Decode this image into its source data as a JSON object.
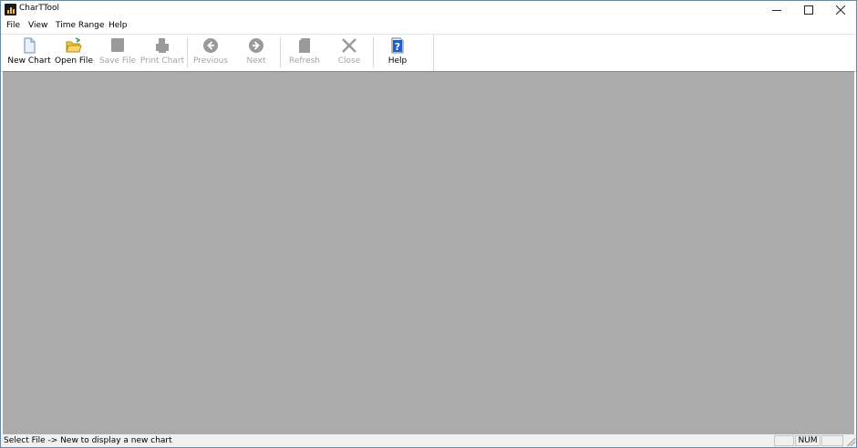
{
  "window": {
    "title": "CharTTool"
  },
  "menu": {
    "items": [
      "File",
      "View",
      "Time Range",
      "Help"
    ]
  },
  "toolbar": {
    "buttons": [
      {
        "label": "New Chart",
        "icon": "new-document-icon",
        "enabled": true
      },
      {
        "label": "Open File",
        "icon": "open-folder-icon",
        "enabled": true
      },
      {
        "label": "Save File",
        "icon": "save-icon",
        "enabled": false
      },
      {
        "label": "Print Chart",
        "icon": "print-icon",
        "enabled": false
      },
      {
        "label": "Previous",
        "icon": "arrow-left-icon",
        "enabled": false
      },
      {
        "label": "Next",
        "icon": "arrow-right-icon",
        "enabled": false
      },
      {
        "label": "Refresh",
        "icon": "refresh-icon",
        "enabled": false
      },
      {
        "label": "Close",
        "icon": "close-x-icon",
        "enabled": false
      },
      {
        "label": "Help",
        "icon": "help-icon",
        "enabled": true
      }
    ]
  },
  "status": {
    "text": "Select File -> New to display a new chart",
    "num_indicator": "NUM"
  },
  "colors": {
    "workspace": "#ababab",
    "help_blue": "#1f5fbf",
    "folder_yellow": "#f2c744"
  }
}
